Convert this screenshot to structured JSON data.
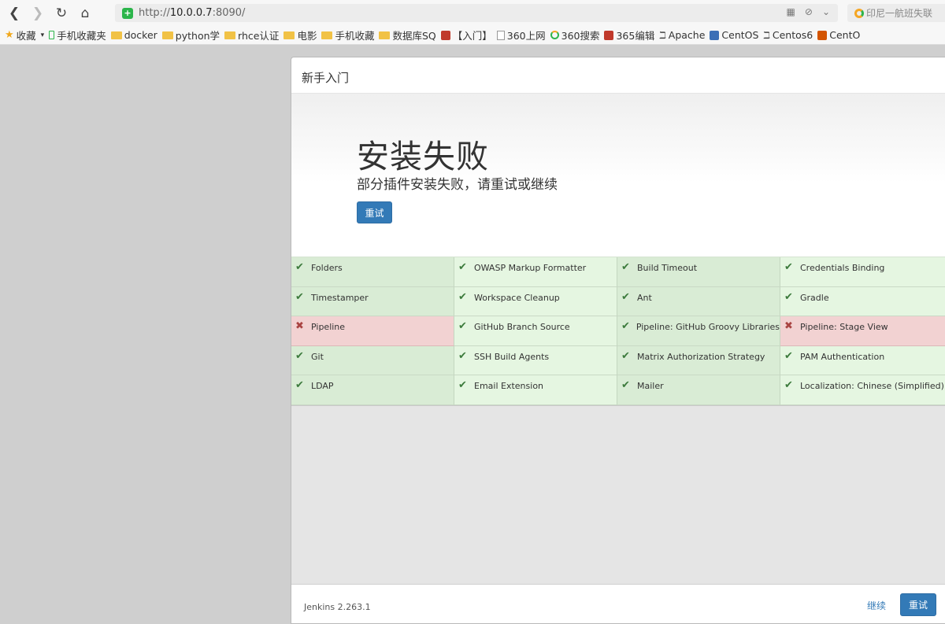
{
  "browser": {
    "url_prefix": "http://",
    "url_host": "10.0.0.7",
    "url_suffix": ":8090/",
    "search_placeholder": "印尼一航班失联",
    "bookmarks": [
      {
        "label": "收藏",
        "icon": "star-icon"
      },
      {
        "label": "手机收藏夹",
        "icon": "phone-icon"
      },
      {
        "label": "docker",
        "icon": "folder-icon"
      },
      {
        "label": "python学",
        "icon": "folder-icon"
      },
      {
        "label": "rhce认证",
        "icon": "folder-icon"
      },
      {
        "label": "电影",
        "icon": "folder-icon"
      },
      {
        "label": "手机收藏",
        "icon": "folder-icon"
      },
      {
        "label": "数据库SQ",
        "icon": "folder-icon"
      },
      {
        "label": "【入门】",
        "icon": "brand-icon"
      },
      {
        "label": "360上网",
        "icon": "doc-icon"
      },
      {
        "label": "360搜索",
        "icon": "ring-icon"
      },
      {
        "label": "365编辑",
        "icon": "brand-icon"
      },
      {
        "label": "Apache",
        "icon": "apache-icon"
      },
      {
        "label": "CentOS",
        "icon": "brand-icon"
      },
      {
        "label": "Centos6",
        "icon": "apache-icon"
      },
      {
        "label": "CentO",
        "icon": "brand-icon"
      }
    ]
  },
  "dialog": {
    "header_title": "新手入门",
    "hero_title": "安装失败",
    "hero_subtitle": "部分插件安装失败，请重试或继续",
    "retry_label": "重试",
    "plugins": [
      {
        "name": "Folders",
        "status": "ok"
      },
      {
        "name": "OWASP Markup Formatter",
        "status": "ok"
      },
      {
        "name": "Build Timeout",
        "status": "ok"
      },
      {
        "name": "Credentials Binding",
        "status": "ok"
      },
      {
        "name": "Timestamper",
        "status": "ok"
      },
      {
        "name": "Workspace Cleanup",
        "status": "ok"
      },
      {
        "name": "Ant",
        "status": "ok"
      },
      {
        "name": "Gradle",
        "status": "ok"
      },
      {
        "name": "Pipeline",
        "status": "fail"
      },
      {
        "name": "GitHub Branch Source",
        "status": "ok"
      },
      {
        "name": "Pipeline: GitHub Groovy Libraries",
        "status": "ok"
      },
      {
        "name": "Pipeline: Stage View",
        "status": "fail"
      },
      {
        "name": "Git",
        "status": "ok"
      },
      {
        "name": "SSH Build Agents",
        "status": "ok"
      },
      {
        "name": "Matrix Authorization Strategy",
        "status": "ok"
      },
      {
        "name": "PAM Authentication",
        "status": "ok"
      },
      {
        "name": "LDAP",
        "status": "ok"
      },
      {
        "name": "Email Extension",
        "status": "ok"
      },
      {
        "name": "Mailer",
        "status": "ok"
      },
      {
        "name": "Localization: Chinese (Simplified)",
        "status": "ok"
      }
    ],
    "footer_version": "Jenkins 2.263.1",
    "continue_label": "继续",
    "footer_retry_label": "重试"
  },
  "colors": {
    "primary": "#337ab7",
    "success_bg": "#dff0d8",
    "fail_bg": "#f2d2d2",
    "check": "#3c7a3c",
    "cross": "#a94442"
  }
}
